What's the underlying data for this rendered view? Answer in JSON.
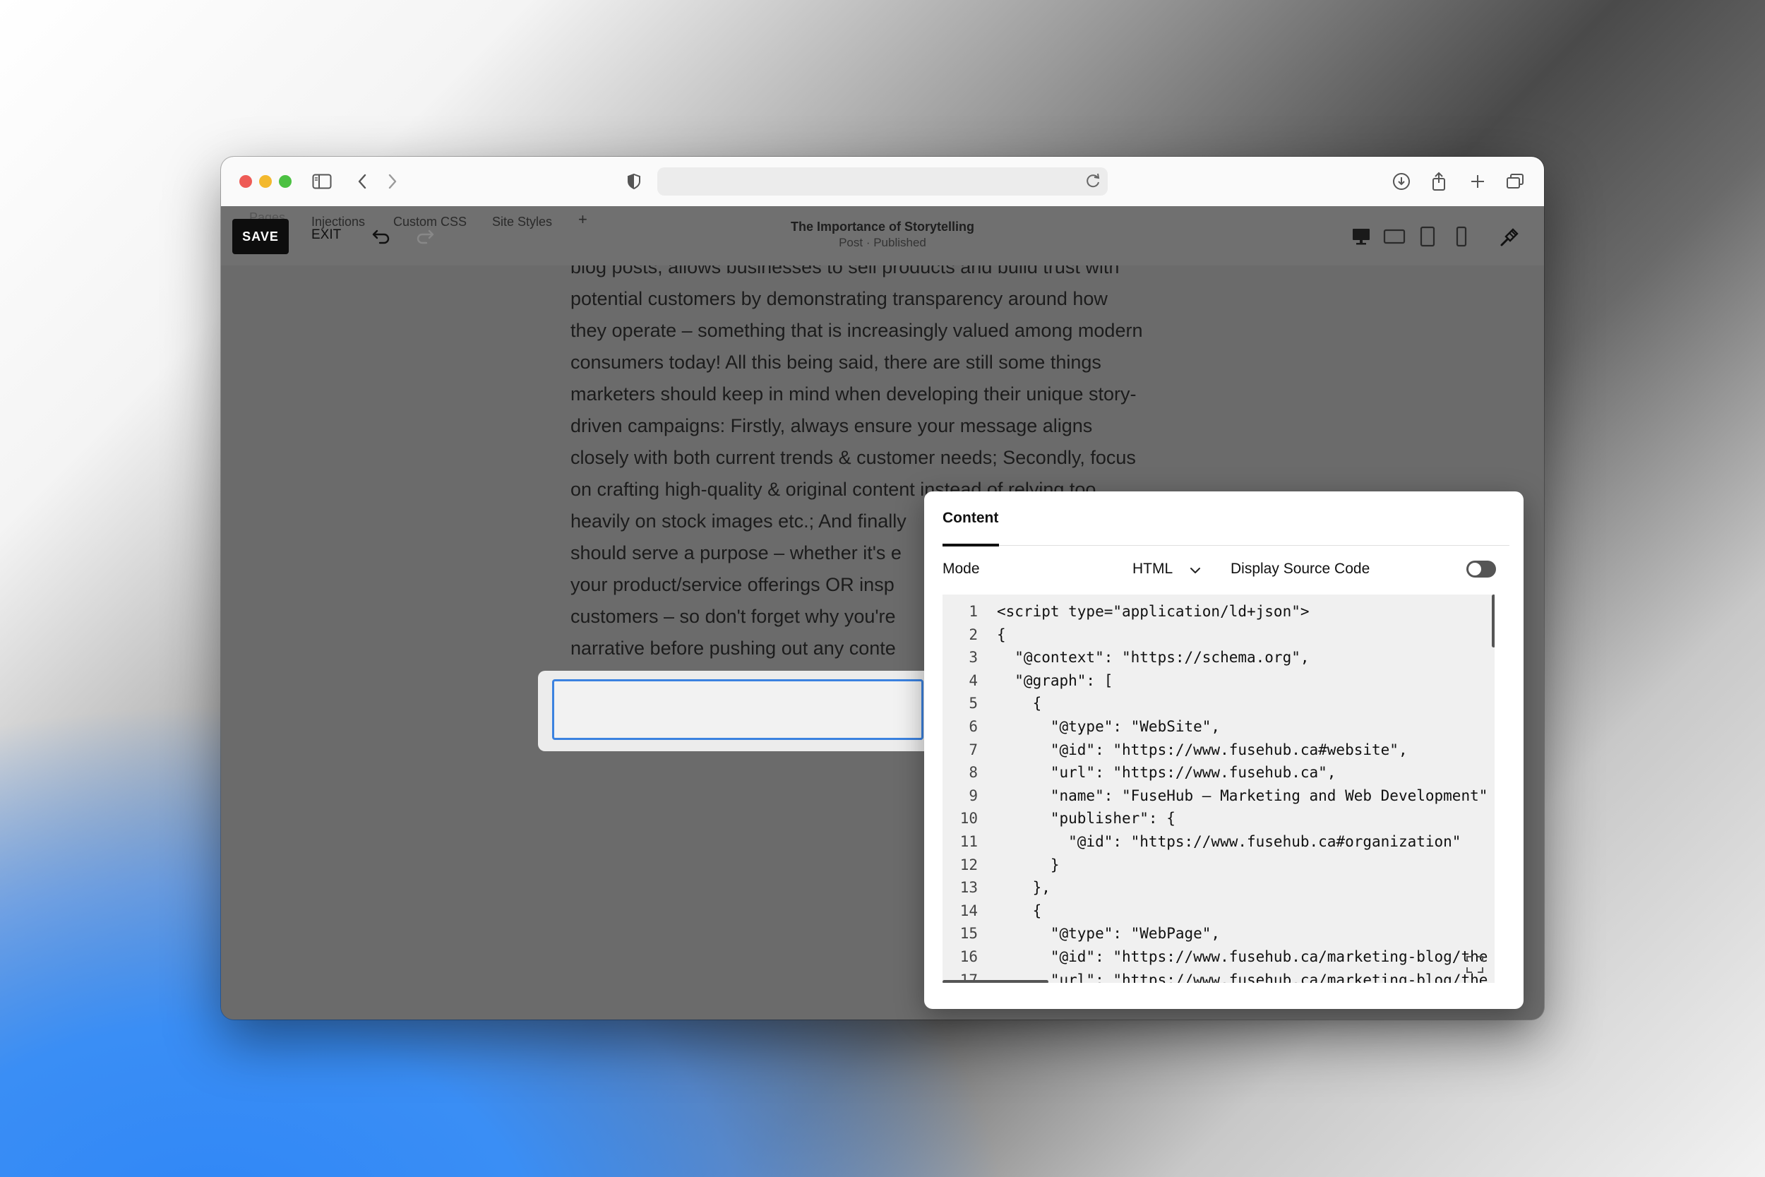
{
  "browser": {
    "icons": [
      "sidebar-icon",
      "back-icon",
      "forward-icon",
      "shield-icon",
      "reload-icon",
      "download-icon",
      "share-icon",
      "new-tab-icon",
      "tabs-overview-icon"
    ]
  },
  "editor_bar": {
    "save_label": "SAVE",
    "exit_label": "EXIT",
    "tabs": [
      "Pages",
      "Injections",
      "Custom CSS",
      "Site Styles",
      "+"
    ],
    "post_title": "The Importance of Storytelling",
    "post_status": "Post · Published"
  },
  "article": {
    "lines": [
      "blog posts, allows businesses to sell products and build trust with",
      "potential customers by demonstrating transparency around how",
      "they operate – something that is increasingly valued among modern",
      "consumers today!   All this being said, there are still some things",
      "marketers should keep in mind when developing their unique story-",
      "driven campaigns: Firstly, always ensure your message aligns",
      "closely with both current trends & customer needs; Secondly, focus",
      "on crafting high-quality & original content instead of relying too",
      "heavily on stock images etc.; And finally",
      "should serve a purpose – whether it's e",
      "your product/service offerings OR insp",
      "customers – so don't forget why you're",
      "narrative before pushing out any conte"
    ]
  },
  "panel": {
    "tab_label": "Content",
    "mode_label": "Mode",
    "mode_value": "HTML",
    "display_source_label": "Display Source Code",
    "display_source_on": false,
    "code": [
      {
        "n": "1",
        "text": "<script type=\"application/ld+json\">"
      },
      {
        "n": "2",
        "text": "{"
      },
      {
        "n": "3",
        "text": "  \"@context\": \"https://schema.org\","
      },
      {
        "n": "4",
        "text": "  \"@graph\": ["
      },
      {
        "n": "5",
        "text": "    {"
      },
      {
        "n": "6",
        "text": "      \"@type\": \"WebSite\","
      },
      {
        "n": "7",
        "text": "      \"@id\": \"https://www.fusehub.ca#website\","
      },
      {
        "n": "8",
        "text": "      \"url\": \"https://www.fusehub.ca\","
      },
      {
        "n": "9",
        "text": "      \"name\": \"FuseHub – Marketing and Web Development\""
      },
      {
        "n": "10",
        "text": "      \"publisher\": {"
      },
      {
        "n": "11",
        "text": "        \"@id\": \"https://www.fusehub.ca#organization\""
      },
      {
        "n": "12",
        "text": "      }"
      },
      {
        "n": "13",
        "text": "    },"
      },
      {
        "n": "14",
        "text": "    {"
      },
      {
        "n": "15",
        "text": "      \"@type\": \"WebPage\","
      },
      {
        "n": "16",
        "text": "      \"@id\": \"https://www.fusehub.ca/marketing-blog/the"
      },
      {
        "n": "17",
        "text": "      \"url\": \"https://www.fusehub.ca/marketing-blog/the"
      }
    ]
  },
  "colors": {
    "save_bg": "#0d0d0d",
    "focus_border": "#3b82e0",
    "canvas_bg": "#6b6b6b"
  }
}
